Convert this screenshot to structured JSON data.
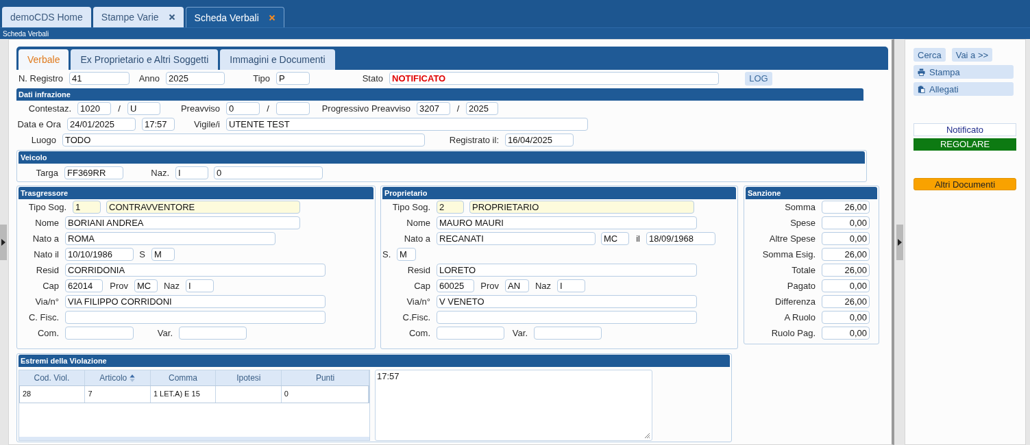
{
  "app_tabs": [
    {
      "label": "demoCDS Home",
      "selected": false,
      "closable": false
    },
    {
      "label": "Stampe Varie",
      "selected": false,
      "closable": true
    },
    {
      "label": "Scheda Verbali",
      "selected": true,
      "closable": true
    }
  ],
  "page_title": "Scheda Verbali",
  "form_tabs": [
    {
      "label": "Verbale",
      "selected": true
    },
    {
      "label": "Ex Proprietario e Altri Soggetti",
      "selected": false
    },
    {
      "label": "Immagini e Documenti",
      "selected": false
    }
  ],
  "header": {
    "registro": {
      "label": "N. Registro",
      "value": "41"
    },
    "anno": {
      "label": "Anno",
      "value": "2025"
    },
    "tipo": {
      "label": "Tipo",
      "value": "P"
    },
    "stato": {
      "label": "Stato",
      "value": "NOTIFICATO"
    },
    "log_button": "LOG"
  },
  "infrazione": {
    "title": "Dati infrazione",
    "contestazione": {
      "label": "Contestaz.",
      "number": "1020",
      "sep": "/",
      "series": "U"
    },
    "preavviso": {
      "label": "Preavviso",
      "number": "0",
      "sep": "/"
    },
    "progressivo": {
      "label": "Progressivo Preavviso",
      "number": "3207",
      "sep": "/",
      "year": "2025"
    },
    "data_ora": {
      "label": "Data e Ora",
      "date": "24/01/2025",
      "time": "17:57"
    },
    "vigile": {
      "label": "Vigile/i",
      "value": "UTENTE TEST"
    },
    "luogo": {
      "label": "Luogo",
      "value": "TODO"
    },
    "registrato": {
      "label": "Registrato il:",
      "value": "16/04/2025"
    }
  },
  "veicolo": {
    "title": "Veicolo",
    "targa": {
      "label": "Targa",
      "value": "FF369RR"
    },
    "naz": {
      "label": "Naz.",
      "code": "I",
      "value": "0"
    }
  },
  "trasgressore": {
    "title": "Trasgressore",
    "tipo_sog": {
      "label": "Tipo Sog.",
      "code": "1",
      "value": "CONTRAVVENTORE"
    },
    "nome": {
      "label": "Nome",
      "value": "BORIANI ANDREA"
    },
    "nato_a": {
      "label": "Nato a",
      "value": "ROMA"
    },
    "nato_il": {
      "label": "Nato il",
      "value": "10/10/1986"
    },
    "sesso": {
      "label": "S",
      "value": "M"
    },
    "resid": {
      "label": "Resid",
      "value": "CORRIDONIA"
    },
    "cap": {
      "label": "Cap",
      "value": "62014"
    },
    "prov": {
      "label": "Prov",
      "value": "MC"
    },
    "naz": {
      "label": "Naz",
      "value": "I"
    },
    "via": {
      "label": "Via/n°",
      "value": "VIA FILIPPO CORRIDONI"
    },
    "cf": {
      "label": "C. Fisc."
    },
    "com": {
      "label": "Com."
    },
    "var": {
      "label": "Var."
    }
  },
  "proprietario": {
    "title": "Proprietario",
    "tipo_sog": {
      "label": "Tipo Sog.",
      "code": "2",
      "value": "PROPRIETARIO"
    },
    "nome": {
      "label": "Nome",
      "value": "MAURO MAURI"
    },
    "nato_a": {
      "label": "Nato a",
      "value": "RECANATI",
      "prov": "MC"
    },
    "nato_il": {
      "label": "il",
      "value": "18/09/1968"
    },
    "sesso": {
      "label": "S.",
      "value": "M"
    },
    "resid": {
      "label": "Resid",
      "value": "LORETO"
    },
    "cap": {
      "label": "Cap",
      "value": "60025"
    },
    "prov": {
      "label": "Prov",
      "value": "AN"
    },
    "naz": {
      "label": "Naz",
      "value": "I"
    },
    "via": {
      "label": "Via/n°",
      "value": "V VENETO"
    },
    "cf": {
      "label": "C.Fisc."
    },
    "com": {
      "label": "Com."
    },
    "var": {
      "label": "Var."
    }
  },
  "sanzione": {
    "title": "Sanzione",
    "rows": [
      {
        "label": "Somma",
        "value": "26,00"
      },
      {
        "label": "Spese",
        "value": "0,00"
      },
      {
        "label": "Altre Spese",
        "value": "0,00"
      },
      {
        "label": "Somma Esig.",
        "value": "26,00"
      },
      {
        "label": "Totale",
        "value": "26,00"
      },
      {
        "label": "Pagato",
        "value": "0,00"
      },
      {
        "label": "Differenza",
        "value": "26,00"
      },
      {
        "label": "A Ruolo",
        "value": "0,00"
      },
      {
        "label": "Ruolo Pag.",
        "value": "0,00"
      }
    ]
  },
  "violazione": {
    "title": "Estremi della Violazione",
    "columns": [
      {
        "label": "Cod. Viol.",
        "sorted": false
      },
      {
        "label": "Articolo",
        "sorted": true
      },
      {
        "label": "Comma",
        "sorted": false
      },
      {
        "label": "Ipotesi",
        "sorted": false
      },
      {
        "label": "Punti",
        "sorted": false
      }
    ],
    "rows": [
      [
        "28",
        "7",
        "1 LET.A) E 15",
        null,
        "0"
      ]
    ],
    "note": "17:57"
  },
  "sidebar": {
    "buttons": [
      {
        "label": "Cerca",
        "kind": "small"
      },
      {
        "label": "Vai a >>",
        "kind": "small"
      },
      {
        "label": "Stampa",
        "kind": "print"
      },
      {
        "label": "Allegati",
        "kind": "attach"
      }
    ],
    "status": "Notificato",
    "badge": "REGOLARE",
    "documents_button": "Altri Documenti"
  }
}
